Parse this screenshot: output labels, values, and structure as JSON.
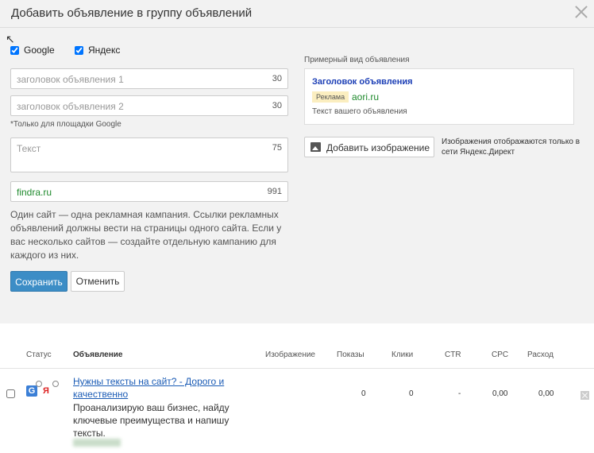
{
  "dialog": {
    "title": "Добавить объявление в группу объявлений"
  },
  "platforms": {
    "google_label": "Google",
    "yandex_label": "Яндекс",
    "google_checked": true,
    "yandex_checked": true
  },
  "form": {
    "headline1": {
      "placeholder": "заголовок объявления 1",
      "counter": "30"
    },
    "headline2": {
      "placeholder": "заголовок объявления 2",
      "counter": "30"
    },
    "google_note": "*Только для площадки Google",
    "text": {
      "placeholder": "Текст",
      "counter": "75"
    },
    "url": {
      "value": "findra.ru",
      "counter": "991"
    },
    "help_text": "Один сайт — одна рекламная кампания. Ссылки рекламных объявлений должны вести на страницы одного сайта. Если у вас несколько сайтов — создайте отдельную кампанию для каждого из них.",
    "save_label": "Сохранить",
    "cancel_label": "Отменить"
  },
  "preview": {
    "label": "Примерный вид объявления",
    "title": "Заголовок объявления",
    "badge": "Реклама",
    "domain": "aori.ru",
    "text": "Текст вашего объявления"
  },
  "image": {
    "button_label": "Добавить изображение",
    "note": "Изображения отображаются только в сети Яндекс.Директ"
  },
  "table": {
    "headers": {
      "status": "Статус",
      "ad": "Объявление",
      "image": "Изображение",
      "shows": "Показы",
      "clicks": "Клики",
      "ctr": "CTR",
      "cpc": "CPC",
      "spend": "Расход"
    },
    "row": {
      "ad_title": "Нужны тексты на сайт? - Дорого и качественно",
      "ad_body": "Проанализирую ваш бизнес, найду ключевые преимущества и напишу тексты.",
      "google_icon": "G",
      "yandex_icon": "Я",
      "shows": "0",
      "clicks": "0",
      "ctr": "-",
      "cpc": "0,00",
      "spend": "0,00"
    }
  }
}
